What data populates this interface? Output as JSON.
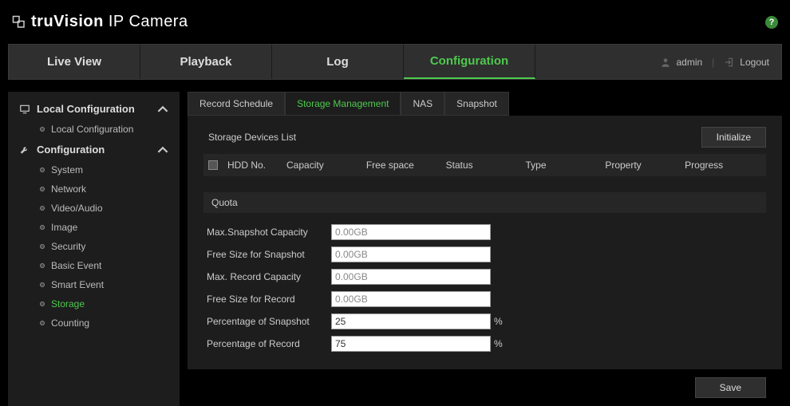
{
  "brand": {
    "name_bold": "truVision",
    "name_light": " IP Camera"
  },
  "nav": {
    "tabs": [
      "Live View",
      "Playback",
      "Log",
      "Configuration"
    ],
    "active_index": 3
  },
  "user": {
    "name": "admin",
    "logout": "Logout"
  },
  "sidebar": {
    "groups": [
      {
        "title": "Local Configuration",
        "items": [
          {
            "label": "Local Configuration",
            "active": false
          }
        ]
      },
      {
        "title": "Configuration",
        "items": [
          {
            "label": "System",
            "active": false
          },
          {
            "label": "Network",
            "active": false
          },
          {
            "label": "Video/Audio",
            "active": false
          },
          {
            "label": "Image",
            "active": false
          },
          {
            "label": "Security",
            "active": false
          },
          {
            "label": "Basic Event",
            "active": false
          },
          {
            "label": "Smart Event",
            "active": false
          },
          {
            "label": "Storage",
            "active": true
          },
          {
            "label": "Counting",
            "active": false
          }
        ]
      }
    ]
  },
  "subtabs": {
    "items": [
      "Record Schedule",
      "Storage Management",
      "NAS",
      "Snapshot"
    ],
    "active_index": 1
  },
  "devices": {
    "title": "Storage Devices List",
    "initialize": "Initialize",
    "columns": [
      "HDD No.",
      "Capacity",
      "Free space",
      "Status",
      "Type",
      "Property",
      "Progress"
    ]
  },
  "quota": {
    "title": "Quota",
    "rows": [
      {
        "label": "Max.Snapshot Capacity",
        "value": "0.00GB",
        "readonly": true,
        "suffix": ""
      },
      {
        "label": "Free Size for Snapshot",
        "value": "0.00GB",
        "readonly": true,
        "suffix": ""
      },
      {
        "label": "Max. Record Capacity",
        "value": "0.00GB",
        "readonly": true,
        "suffix": ""
      },
      {
        "label": "Free Size for Record",
        "value": "0.00GB",
        "readonly": true,
        "suffix": ""
      },
      {
        "label": "Percentage of Snapshot",
        "value": "25",
        "readonly": false,
        "suffix": "%"
      },
      {
        "label": "Percentage of Record",
        "value": "75",
        "readonly": false,
        "suffix": "%"
      }
    ]
  },
  "footer": {
    "save": "Save"
  }
}
